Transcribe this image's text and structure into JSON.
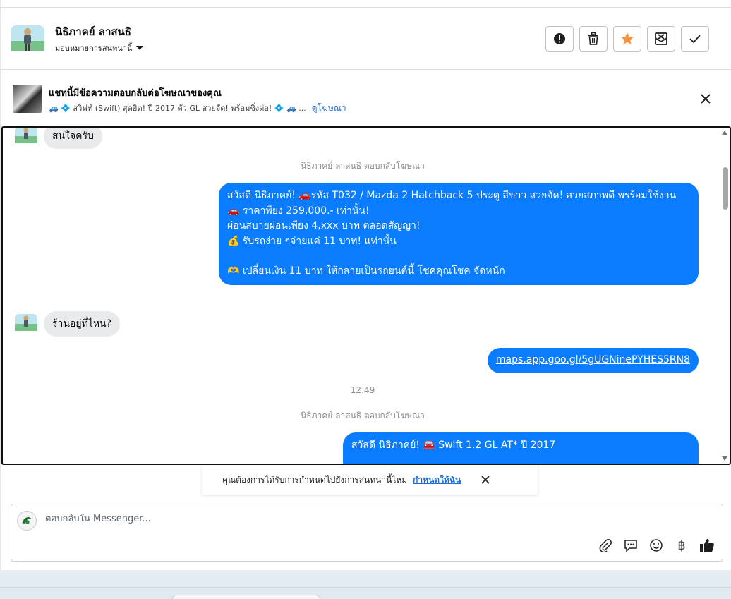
{
  "header": {
    "contact_name": "นิธิภาคย์ ลาสนธิ",
    "assign_label": "มอบหมายการสนทนานี้",
    "actions": [
      {
        "name": "report-button",
        "icon": "exclamation-icon"
      },
      {
        "name": "delete-button",
        "icon": "trash-icon"
      },
      {
        "name": "star-button",
        "icon": "star-icon"
      },
      {
        "name": "mark-unread-button",
        "icon": "envelope-x-icon"
      },
      {
        "name": "mark-done-button",
        "icon": "check-icon"
      }
    ],
    "star_color": "#f5923e"
  },
  "ad": {
    "title": "แชทนี้มีข้อความตอบกลับต่อโฆษณาของคุณ",
    "subtitle": "🚙 💠 สวิฟท์ (Swift) สุดฮิต! ปี 2017 ตัว GL สวยจัด! พร้อมซิ่งต่อ! 💠 🚙 ...",
    "link": "ดูโฆษณา"
  },
  "chat": {
    "msg_interested": "สนใจครับ",
    "reply_line_1": "นิธิภาคย์ ลาสนธิ ตอบกลับโฆษณา",
    "out_msg_1": {
      "line1": "สวัสดี นิธิภาคย์! 🚗รหัส T032 /  Mazda 2 Hatchback 5 ประตู สีขาว สวยจัด! สวยสภาพดี พรร้อมใช้งาน",
      "line2": "🚗 ราคาพียง 259,000.- เท่านั้น!",
      "line3": "ผ่อนสบายผ่อนเพียง 4,xxx บาท ตลอดสัญญา!",
      "line4": "💰 รับรถง่าย ๆจ่ายแค่ 11 บาท! แท่านั้น",
      "line5": "🫶 เปลี่ยนเงิน 11 บาท ให้กลายเป็นรถยนต์นี้ โชคคุณโชค จัดหนัก"
    },
    "msg_where": "ร้านอยู่ที่ไหน?",
    "map_link": "maps.app.goo.gl/5gUGNinePYHES5RN8",
    "timestamp": "12:49",
    "reply_line_2": "นิธิภาคย์ ลาสนธิ ตอบกลับโฆษณา",
    "out_msg_2": "สวัสดี นิธิภาคย์! 🚘 Swift 1.2 GL AT* ปี 2017",
    "bubble_color": "#0a7cff"
  },
  "notice": {
    "text": "คุณต้องการได้รับการกำหนดไปยังการสนทนานี้ไหม",
    "link": "กำหนดให้ฉัน"
  },
  "composer": {
    "placeholder": "ตอบกลับใน Messenger...",
    "tools": [
      "paperclip-icon",
      "saved-reply-icon",
      "emoji-icon",
      "baht-icon",
      "thumbs-up-icon"
    ],
    "baht_symbol": "฿"
  }
}
